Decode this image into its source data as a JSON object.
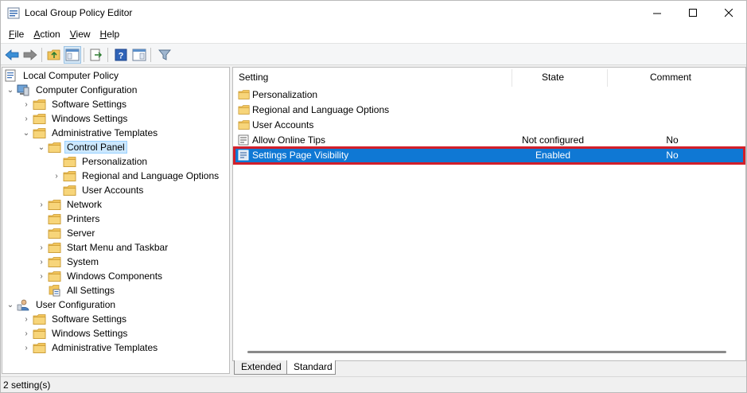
{
  "window": {
    "title": "Local Group Policy Editor"
  },
  "menu": [
    {
      "label": "File",
      "ul": "F",
      "rest": "ile"
    },
    {
      "label": "Action",
      "ul": "A",
      "rest": "ction"
    },
    {
      "label": "View",
      "ul": "V",
      "rest": "iew"
    },
    {
      "label": "Help",
      "ul": "H",
      "rest": "elp"
    }
  ],
  "tree": {
    "root": "Local Computer Policy",
    "computer_config": "Computer Configuration",
    "cc_software": "Software Settings",
    "cc_windows": "Windows Settings",
    "cc_admin": "Administrative Templates",
    "control_panel": "Control Panel",
    "cp_personalization": "Personalization",
    "cp_regional": "Regional and Language Options",
    "cp_user_accounts": "User Accounts",
    "network": "Network",
    "printers": "Printers",
    "server": "Server",
    "start_menu": "Start Menu and Taskbar",
    "system": "System",
    "windows_components": "Windows Components",
    "all_settings": "All Settings",
    "user_config": "User Configuration",
    "uc_software": "Software Settings",
    "uc_windows": "Windows Settings",
    "uc_admin": "Administrative Templates"
  },
  "list": {
    "columns": {
      "setting": "Setting",
      "state": "State",
      "comment": "Comment"
    },
    "rows": [
      {
        "setting": "Personalization",
        "state": "",
        "comment": ""
      },
      {
        "setting": "Regional and Language Options",
        "state": "",
        "comment": ""
      },
      {
        "setting": "User Accounts",
        "state": "",
        "comment": ""
      },
      {
        "setting": "Allow Online Tips",
        "state": "Not configured",
        "comment": "No"
      },
      {
        "setting": "Settings Page Visibility",
        "state": "Enabled",
        "comment": "No"
      }
    ]
  },
  "tabs": {
    "extended": "Extended",
    "standard": "Standard"
  },
  "status": {
    "text": "2 setting(s)"
  },
  "colors": {
    "selection": "#0f78d4",
    "highlight_border": "#d21f2a",
    "folder": "#f2c55c"
  }
}
